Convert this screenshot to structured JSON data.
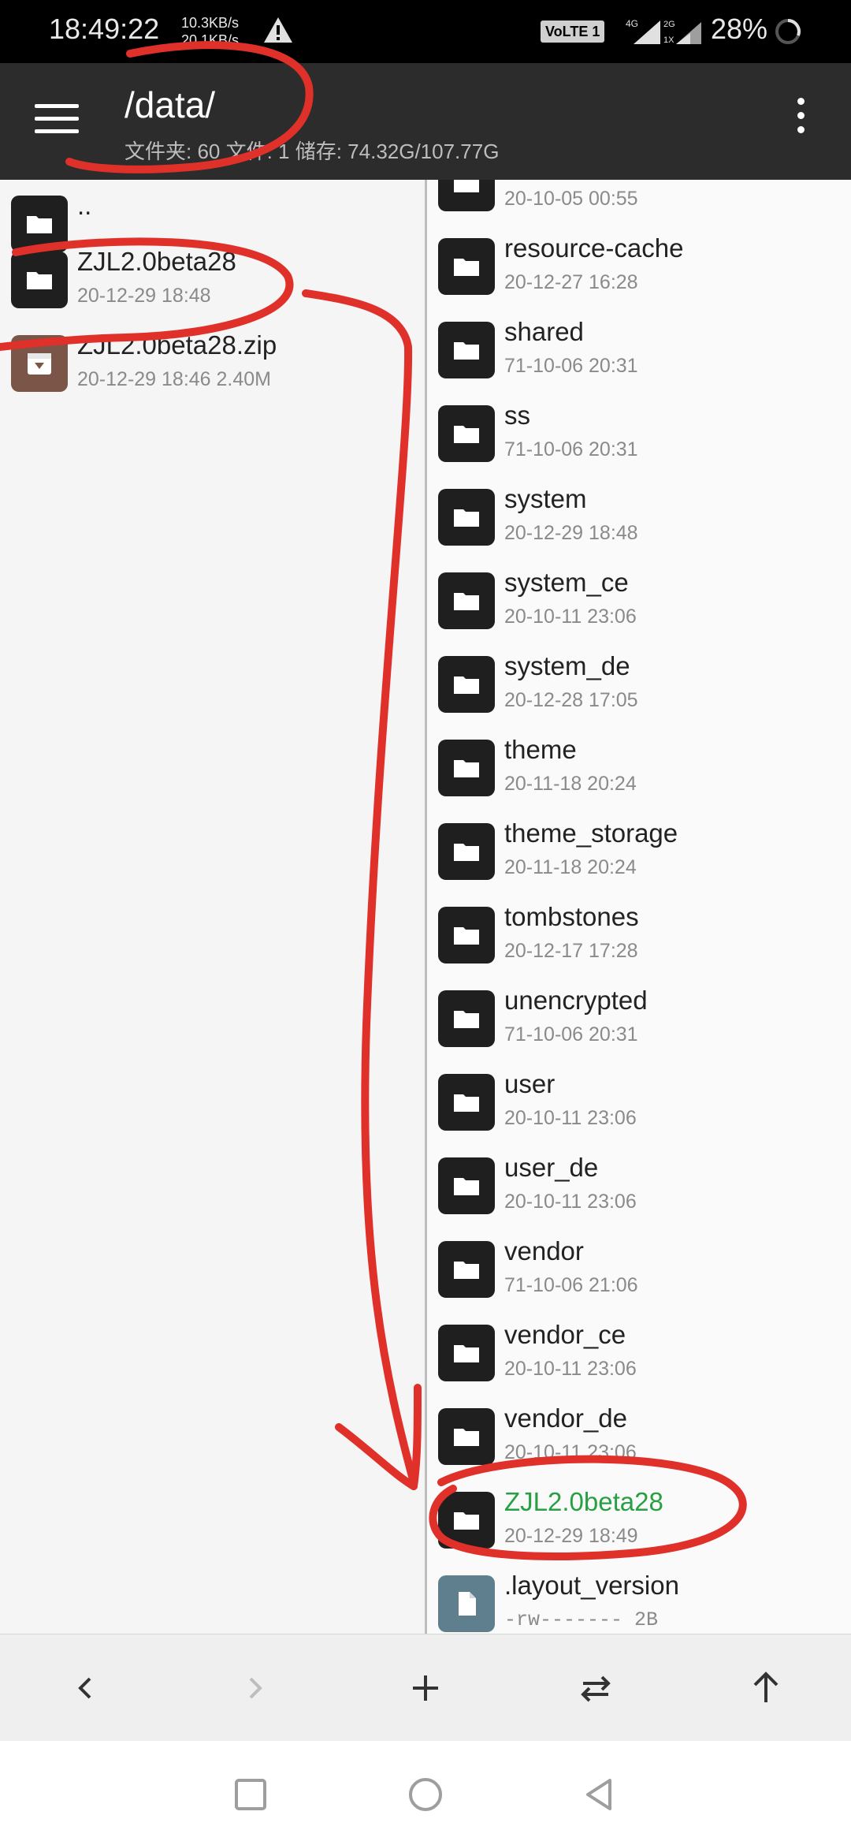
{
  "status_bar": {
    "time": "18:49:22",
    "speed_up": "10.3KB/s",
    "speed_down": "20.1KB/s",
    "volte": "VoLTE 1",
    "net1": "4G",
    "net2": "2G",
    "battery": "28%"
  },
  "app_bar": {
    "path": "/data/",
    "summary": "文件夹: 60  文件: 1  储存: 74.32G/107.77G",
    "menu_icon": "hamburger-menu-icon",
    "overflow_icon": "more-vert-icon"
  },
  "left_pane": {
    "items": [
      {
        "name": "..",
        "meta": "",
        "type": "folder"
      },
      {
        "name": "ZJL2.0beta28",
        "meta": "20-12-29 18:48",
        "type": "folder"
      },
      {
        "name": "ZJL2.0beta28.zip",
        "meta": "20-12-29 18:46  2.40M",
        "type": "zip"
      }
    ]
  },
  "right_pane": {
    "items": [
      {
        "name": "",
        "meta": "20-10-05 00:55",
        "type": "folder"
      },
      {
        "name": "resource-cache",
        "meta": "20-12-27 16:28",
        "type": "folder"
      },
      {
        "name": "shared",
        "meta": "71-10-06 20:31",
        "type": "folder"
      },
      {
        "name": "ss",
        "meta": "71-10-06 20:31",
        "type": "folder"
      },
      {
        "name": "system",
        "meta": "20-12-29 18:48",
        "type": "folder"
      },
      {
        "name": "system_ce",
        "meta": "20-10-11 23:06",
        "type": "folder"
      },
      {
        "name": "system_de",
        "meta": "20-12-28 17:05",
        "type": "folder"
      },
      {
        "name": "theme",
        "meta": "20-11-18 20:24",
        "type": "folder"
      },
      {
        "name": "theme_storage",
        "meta": "20-11-18 20:24",
        "type": "folder"
      },
      {
        "name": "tombstones",
        "meta": "20-12-17 17:28",
        "type": "folder"
      },
      {
        "name": "unencrypted",
        "meta": "71-10-06 20:31",
        "type": "folder"
      },
      {
        "name": "user",
        "meta": "20-10-11 23:06",
        "type": "folder"
      },
      {
        "name": "user_de",
        "meta": "20-10-11 23:06",
        "type": "folder"
      },
      {
        "name": "vendor",
        "meta": "71-10-06 21:06",
        "type": "folder"
      },
      {
        "name": "vendor_ce",
        "meta": "20-10-11 23:06",
        "type": "folder"
      },
      {
        "name": "vendor_de",
        "meta": "20-10-11 23:06",
        "type": "folder"
      },
      {
        "name": "ZJL2.0beta28",
        "meta": "20-12-29 18:49",
        "type": "folder",
        "highlight": true
      },
      {
        "name": ".layout_version",
        "meta": "-rw-------  2B",
        "type": "file"
      }
    ]
  },
  "toolbar": {
    "buttons": [
      "back-arrow-icon",
      "forward-arrow-icon",
      "add-icon",
      "swap-panes-icon",
      "up-arrow-icon"
    ]
  },
  "nav_bar": {
    "buttons": [
      "recents-square-icon",
      "home-circle-icon",
      "back-triangle-icon"
    ]
  },
  "colors": {
    "app_bar": "#2c2c2c",
    "highlight_text": "#27a043",
    "annotation": "#e0302a"
  }
}
